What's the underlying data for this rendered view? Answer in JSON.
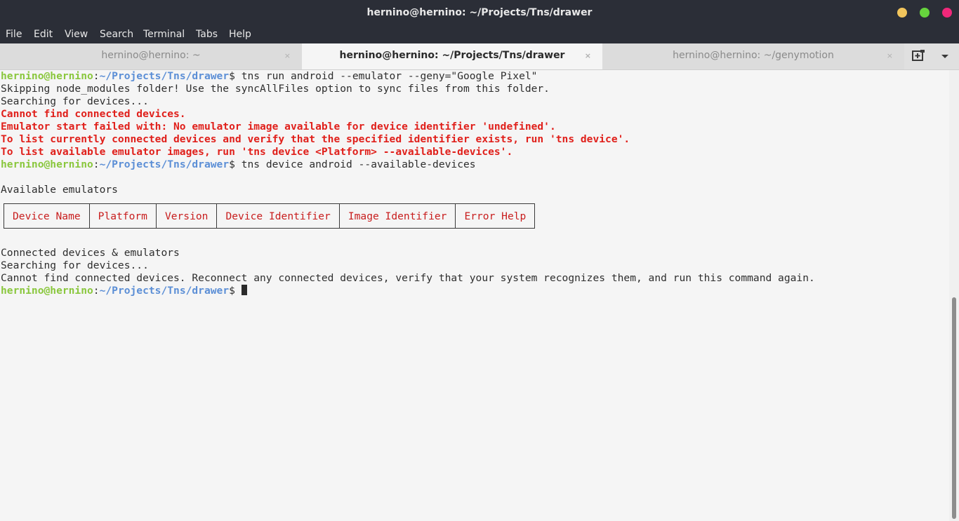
{
  "window": {
    "title": "hernino@hernino: ~/Projects/Tns/drawer",
    "controls": {
      "minimize_color": "#f2c55c",
      "maximize_color": "#66d33d",
      "close_color": "#f0287a"
    }
  },
  "menu": [
    "File",
    "Edit",
    "View",
    "Search",
    "Terminal",
    "Tabs",
    "Help"
  ],
  "tabs": [
    {
      "label": "hernino@hernino: ~",
      "close": "×"
    },
    {
      "label": "hernino@hernino: ~/Projects/Tns/drawer",
      "close": "×"
    },
    {
      "label": "hernino@hernino: ~/genymotion",
      "close": "×"
    }
  ],
  "tab_actions": {
    "new_tab_icon": "new-tab-icon",
    "menu_icon": "chevron-down-icon"
  },
  "prompt": {
    "user": "hernino@hernino",
    "sep": ":",
    "path": "~/Projects/Tns/drawer",
    "symbol": "$ "
  },
  "terminal": {
    "cmd1": "tns run android --emulator --geny=\"Google Pixel\"",
    "out1": "Skipping node_modules folder! Use the syncAllFiles option to sync files from this folder.",
    "out2": "Searching for devices...",
    "err1": "Cannot find connected devices.",
    "err2": "Emulator start failed with: No emulator image available for device identifier 'undefined'.",
    "err3": "To list currently connected devices and verify that the specified identifier exists, run 'tns device'.",
    "err4": "To list available emulator images, run 'tns device <Platform> --available-devices'.",
    "cmd2": "tns device android --available-devices",
    "out3": "Available emulators",
    "table_headers": [
      "Device Name",
      "Platform",
      "Version",
      "Device Identifier",
      "Image Identifier",
      "Error Help"
    ],
    "out4": "Connected devices & emulators",
    "out5": "Searching for devices...",
    "out6": "Cannot find connected devices. Reconnect any connected devices, verify that your system recognizes them, and run this command again."
  },
  "colors": {
    "background": "#f5f5f5",
    "titlebar": "#2b2e37",
    "error": "#e0201b",
    "prompt_user": "#8ac73d",
    "prompt_path": "#5c8fd6"
  }
}
